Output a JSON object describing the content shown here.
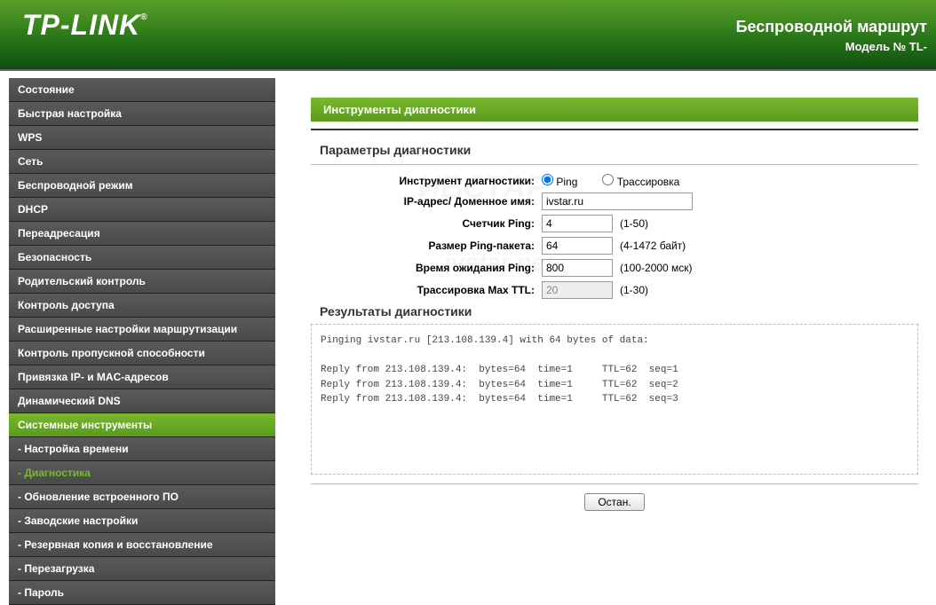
{
  "header": {
    "logo": "TP-LINK",
    "title": "Беспроводной маршрут",
    "model": "Модель № TL-"
  },
  "sidebar": {
    "items": [
      {
        "label": "Состояние"
      },
      {
        "label": "Быстрая настройка"
      },
      {
        "label": "WPS"
      },
      {
        "label": "Сеть"
      },
      {
        "label": "Беспроводной режим"
      },
      {
        "label": "DHCP"
      },
      {
        "label": "Переадресация"
      },
      {
        "label": "Безопасность"
      },
      {
        "label": "Родительский контроль"
      },
      {
        "label": "Контроль доступа"
      },
      {
        "label": "Расширенные настройки маршрутизации"
      },
      {
        "label": "Контроль пропускной способности"
      },
      {
        "label": "Привязка IP- и MAC-адресов"
      },
      {
        "label": "Динамический DNS"
      },
      {
        "label": "Системные инструменты"
      },
      {
        "label": "- Настройка времени"
      },
      {
        "label": "- Диагностика"
      },
      {
        "label": "- Обновление встроенного ПО"
      },
      {
        "label": "- Заводские настройки"
      },
      {
        "label": "- Резервная копия и восстановление"
      },
      {
        "label": "- Перезагрузка"
      },
      {
        "label": "- Пароль"
      }
    ]
  },
  "main": {
    "page_title": "Инструменты диагностики",
    "params_title": "Параметры диагностики",
    "labels": {
      "tool": "Инструмент диагностики:",
      "ip": "IP-адрес/ Доменное имя:",
      "ping_count": "Счетчик Ping:",
      "packet_size": "Размер Ping-пакета:",
      "timeout": "Время ожидания Ping:",
      "max_ttl": "Трассировка Max TTL:"
    },
    "radios": {
      "ping": "Ping",
      "trace": "Трассировка"
    },
    "values": {
      "ip": "ivstar.ru",
      "ping_count": "4",
      "packet_size": "64",
      "timeout": "800",
      "max_ttl": "20"
    },
    "hints": {
      "ping_count": "(1-50)",
      "packet_size": "(4-1472 байт)",
      "timeout": "(100-2000 мск)",
      "max_ttl": "(1-30)"
    },
    "results_title": "Результаты диагностики",
    "results_text": "Pinging ivstar.ru [213.108.139.4] with 64 bytes of data:\n\nReply from 213.108.139.4:  bytes=64  time=1     TTL=62  seq=1\nReply from 213.108.139.4:  bytes=64  time=1     TTL=62  seq=2\nReply from 213.108.139.4:  bytes=64  time=1     TTL=62  seq=3",
    "button": "Остан."
  }
}
